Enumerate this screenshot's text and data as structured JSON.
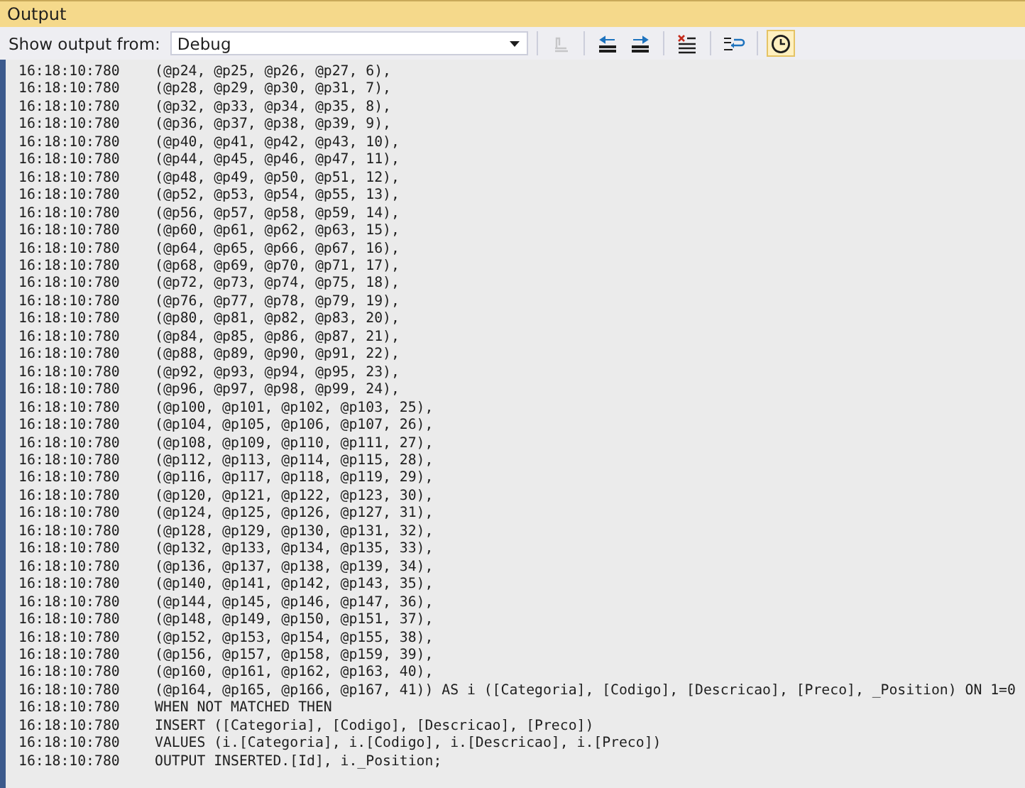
{
  "window": {
    "title": "Output"
  },
  "toolbar": {
    "source_label": "Show output from:",
    "source_value": "Debug",
    "buttons": [
      {
        "kind": "find-source",
        "disabled": true,
        "on": false
      },
      {
        "kind": "prev-message",
        "disabled": false,
        "on": false
      },
      {
        "kind": "next-message",
        "disabled": false,
        "on": false
      },
      {
        "kind": "clear",
        "disabled": false,
        "on": false
      },
      {
        "kind": "word-wrap",
        "disabled": false,
        "on": false
      },
      {
        "kind": "timestamps",
        "disabled": false,
        "on": true
      }
    ]
  },
  "lines": [
    {
      "time": "16:18:10:780",
      "text": "(@p24, @p25, @p26, @p27, 6),"
    },
    {
      "time": "16:18:10:780",
      "text": "(@p28, @p29, @p30, @p31, 7),"
    },
    {
      "time": "16:18:10:780",
      "text": "(@p32, @p33, @p34, @p35, 8),"
    },
    {
      "time": "16:18:10:780",
      "text": "(@p36, @p37, @p38, @p39, 9),"
    },
    {
      "time": "16:18:10:780",
      "text": "(@p40, @p41, @p42, @p43, 10),"
    },
    {
      "time": "16:18:10:780",
      "text": "(@p44, @p45, @p46, @p47, 11),"
    },
    {
      "time": "16:18:10:780",
      "text": "(@p48, @p49, @p50, @p51, 12),"
    },
    {
      "time": "16:18:10:780",
      "text": "(@p52, @p53, @p54, @p55, 13),"
    },
    {
      "time": "16:18:10:780",
      "text": "(@p56, @p57, @p58, @p59, 14),"
    },
    {
      "time": "16:18:10:780",
      "text": "(@p60, @p61, @p62, @p63, 15),"
    },
    {
      "time": "16:18:10:780",
      "text": "(@p64, @p65, @p66, @p67, 16),"
    },
    {
      "time": "16:18:10:780",
      "text": "(@p68, @p69, @p70, @p71, 17),"
    },
    {
      "time": "16:18:10:780",
      "text": "(@p72, @p73, @p74, @p75, 18),"
    },
    {
      "time": "16:18:10:780",
      "text": "(@p76, @p77, @p78, @p79, 19),"
    },
    {
      "time": "16:18:10:780",
      "text": "(@p80, @p81, @p82, @p83, 20),"
    },
    {
      "time": "16:18:10:780",
      "text": "(@p84, @p85, @p86, @p87, 21),"
    },
    {
      "time": "16:18:10:780",
      "text": "(@p88, @p89, @p90, @p91, 22),"
    },
    {
      "time": "16:18:10:780",
      "text": "(@p92, @p93, @p94, @p95, 23),"
    },
    {
      "time": "16:18:10:780",
      "text": "(@p96, @p97, @p98, @p99, 24),"
    },
    {
      "time": "16:18:10:780",
      "text": "(@p100, @p101, @p102, @p103, 25),"
    },
    {
      "time": "16:18:10:780",
      "text": "(@p104, @p105, @p106, @p107, 26),"
    },
    {
      "time": "16:18:10:780",
      "text": "(@p108, @p109, @p110, @p111, 27),"
    },
    {
      "time": "16:18:10:780",
      "text": "(@p112, @p113, @p114, @p115, 28),"
    },
    {
      "time": "16:18:10:780",
      "text": "(@p116, @p117, @p118, @p119, 29),"
    },
    {
      "time": "16:18:10:780",
      "text": "(@p120, @p121, @p122, @p123, 30),"
    },
    {
      "time": "16:18:10:780",
      "text": "(@p124, @p125, @p126, @p127, 31),"
    },
    {
      "time": "16:18:10:780",
      "text": "(@p128, @p129, @p130, @p131, 32),"
    },
    {
      "time": "16:18:10:780",
      "text": "(@p132, @p133, @p134, @p135, 33),"
    },
    {
      "time": "16:18:10:780",
      "text": "(@p136, @p137, @p138, @p139, 34),"
    },
    {
      "time": "16:18:10:780",
      "text": "(@p140, @p141, @p142, @p143, 35),"
    },
    {
      "time": "16:18:10:780",
      "text": "(@p144, @p145, @p146, @p147, 36),"
    },
    {
      "time": "16:18:10:780",
      "text": "(@p148, @p149, @p150, @p151, 37),"
    },
    {
      "time": "16:18:10:780",
      "text": "(@p152, @p153, @p154, @p155, 38),"
    },
    {
      "time": "16:18:10:780",
      "text": "(@p156, @p157, @p158, @p159, 39),"
    },
    {
      "time": "16:18:10:780",
      "text": "(@p160, @p161, @p162, @p163, 40),"
    },
    {
      "time": "16:18:10:780",
      "text": "(@p164, @p165, @p166, @p167, 41)) AS i ([Categoria], [Codigo], [Descricao], [Preco], _Position) ON 1=0"
    },
    {
      "time": "16:18:10:780",
      "text": "WHEN NOT MATCHED THEN"
    },
    {
      "time": "16:18:10:780",
      "text": "INSERT ([Categoria], [Codigo], [Descricao], [Preco])"
    },
    {
      "time": "16:18:10:780",
      "text": "VALUES (i.[Categoria], i.[Codigo], i.[Descricao], i.[Preco])"
    },
    {
      "time": "16:18:10:780",
      "text": "OUTPUT INSERTED.[Id], i._Position;"
    }
  ]
}
